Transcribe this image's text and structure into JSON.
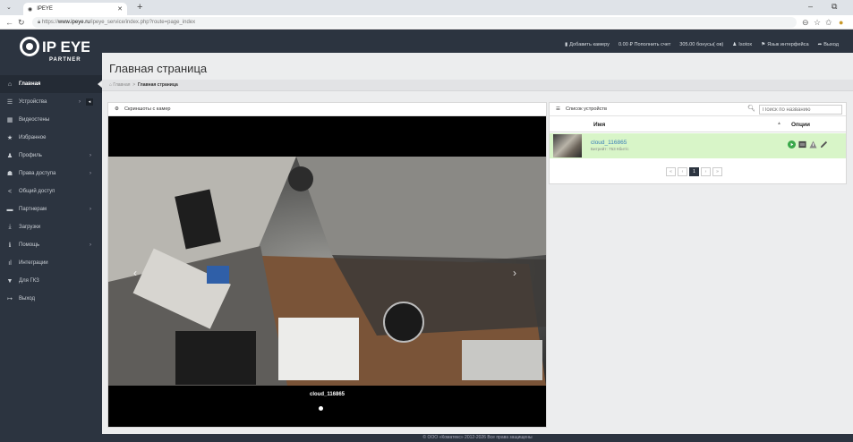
{
  "browser": {
    "tab_title": "IPEYE",
    "url_prefix": "https://",
    "url_domain": "www.ipeye.ru",
    "url_path": "/ipeye_service/index.php?route=page_index"
  },
  "brand": {
    "logo_text": "IP EYE",
    "logo_sub": "PARTNER"
  },
  "toplinks": {
    "add_camera": "Добавить камеру",
    "balance": "0.00 ₽ Пополнить счет",
    "bonus": "305.00 бонусы( ов)",
    "user": "Isotox",
    "language": "Язык интерфейса",
    "logout": "Выход"
  },
  "sidebar": {
    "items": [
      {
        "label": "Главная",
        "icon": "home-icon"
      },
      {
        "label": "Устройства",
        "icon": "list-icon"
      },
      {
        "label": "Видеостены",
        "icon": "grid-icon"
      },
      {
        "label": "Избранное",
        "icon": "star-icon"
      },
      {
        "label": "Профиль",
        "icon": "user-icon"
      },
      {
        "label": "Права доступа",
        "icon": "users-icon"
      },
      {
        "label": "Общий доступ",
        "icon": "share-icon"
      },
      {
        "label": "Партнерам",
        "icon": "partner-icon"
      },
      {
        "label": "Загрузки",
        "icon": "download-icon"
      },
      {
        "label": "Помощь",
        "icon": "info-icon"
      },
      {
        "label": "Интеграции",
        "icon": "integration-icon"
      },
      {
        "label": "Для ГКЗ",
        "icon": "filter-icon"
      },
      {
        "label": "Выход",
        "icon": "logout-icon"
      }
    ]
  },
  "page": {
    "title": "Главная страница",
    "breadcrumb_home": "Главная",
    "breadcrumb_sep": ">",
    "breadcrumb_current": "Главная страница"
  },
  "screenshots_panel": {
    "title": "Скриншоты с камер",
    "caption": "cloud_116865"
  },
  "devices_panel": {
    "title": "Список устройств",
    "search_placeholder": "Поиск по названию",
    "col_name": "Имя",
    "col_options": "Опции",
    "device_name": "cloud_116865",
    "device_bitrate": "Битрейт: 753 Кбит/c",
    "pagination": [
      "«",
      "‹",
      "1",
      "›",
      "»"
    ]
  },
  "footer": "© ООО «Коматекс» 2012-2026 Все права защищены"
}
